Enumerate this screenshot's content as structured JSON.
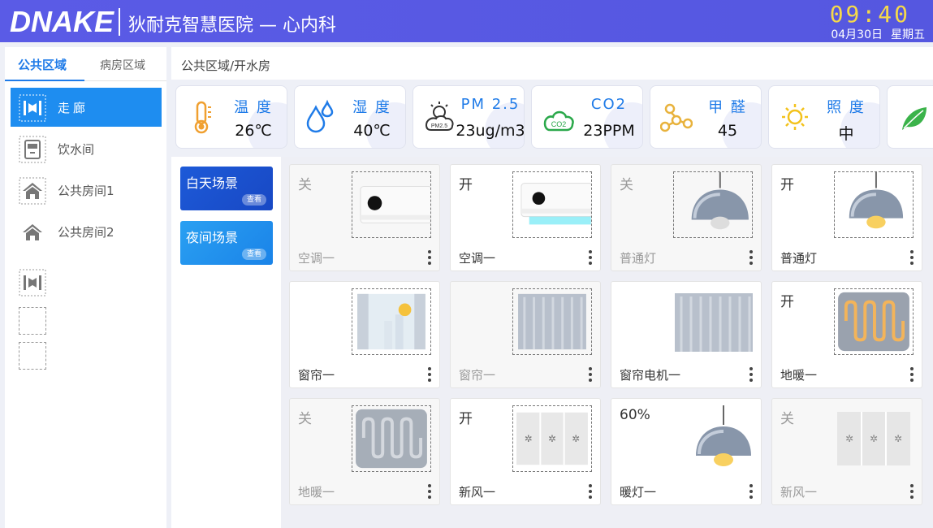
{
  "header": {
    "logo": "DNAKE",
    "title": "狄耐克智慧医院 — 心内科",
    "time": "09:40",
    "date": "04月30日",
    "weekday": "星期五"
  },
  "sidebar": {
    "tabs": [
      "公共区域",
      "病房区域"
    ],
    "items": [
      {
        "label": "走廊",
        "icon": "corridor-icon"
      },
      {
        "label": "饮水间",
        "icon": "water-dispenser-icon"
      },
      {
        "label": "公共房间1",
        "icon": "house-icon"
      },
      {
        "label": "公共房间2",
        "icon": "house-icon"
      }
    ]
  },
  "breadcrumb": "公共区域/开水房",
  "sensors": [
    {
      "name": "温 度",
      "value": "26℃",
      "icon": "thermometer-icon"
    },
    {
      "name": "湿 度",
      "value": "40℃",
      "icon": "humidity-icon"
    },
    {
      "name": "PM 2.5",
      "value": "23ug/m3",
      "icon": "pm25-icon"
    },
    {
      "name": "CO2",
      "value": "23PPM",
      "icon": "co2-icon"
    },
    {
      "name": "甲 醛",
      "value": "45",
      "icon": "formaldehyde-icon"
    },
    {
      "name": "照 度",
      "value": "中",
      "icon": "sun-icon"
    },
    {
      "name": "",
      "value": "",
      "icon": "leaf-icon"
    }
  ],
  "scenes": [
    {
      "label": "白天场景",
      "button": "查看"
    },
    {
      "label": "夜间场景",
      "button": "查看"
    }
  ],
  "devices": [
    {
      "state": "关",
      "name": "空调一",
      "type": "ac-icon"
    },
    {
      "state": "开",
      "name": "空调一",
      "type": "ac-icon"
    },
    {
      "state": "关",
      "name": "普通灯",
      "type": "lamp-icon"
    },
    {
      "state": "开",
      "name": "普通灯",
      "type": "lamp-icon"
    },
    {
      "state": "",
      "name": "窗帘一",
      "type": "window-icon"
    },
    {
      "state": "",
      "name": "窗帘一",
      "type": "curtain-icon"
    },
    {
      "state": "",
      "name": "窗帘电机一",
      "type": "curtain-icon"
    },
    {
      "state": "开",
      "name": "地暖一",
      "type": "floor-heating-icon"
    },
    {
      "state": "关",
      "name": "地暖一",
      "type": "floor-heating-icon"
    },
    {
      "state": "开",
      "name": "新风一",
      "type": "fresh-air-icon"
    },
    {
      "state": "60%",
      "name": "暖灯一",
      "type": "lamp-icon"
    },
    {
      "state": "关",
      "name": "新风一",
      "type": "fresh-air-icon"
    }
  ],
  "colors": {
    "header": "#5a5be6",
    "accent": "#1e8df0",
    "clock": "#f5d94a"
  }
}
